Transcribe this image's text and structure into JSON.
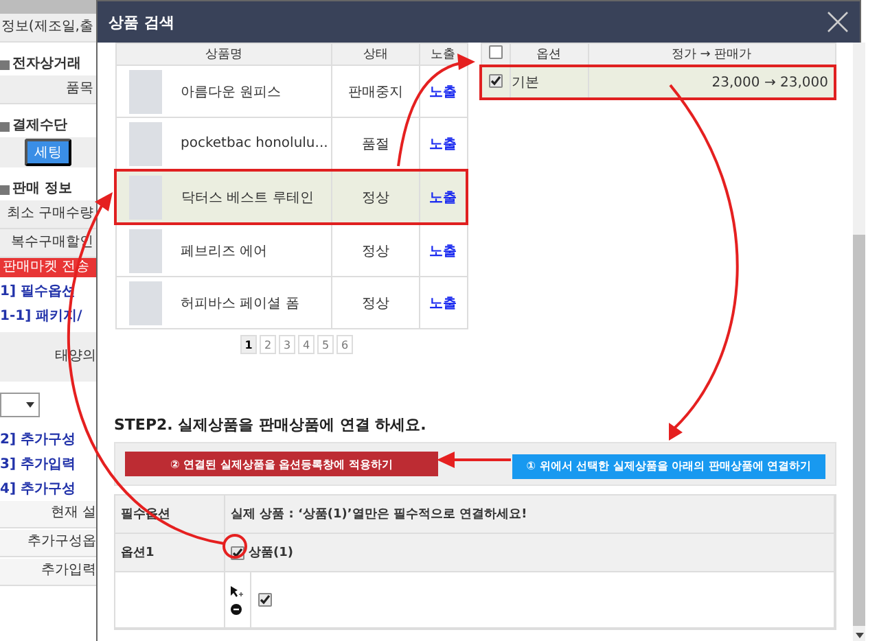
{
  "background": {
    "rows": [
      {
        "kind": "cell",
        "text": "정보(제조일,출"
      },
      {
        "kind": "heading",
        "text": "전자상거래"
      },
      {
        "kind": "cell",
        "text": "품목"
      },
      {
        "kind": "heading",
        "text": "결제수단"
      },
      {
        "kind": "button",
        "text": "세팅"
      },
      {
        "kind": "heading",
        "text": "판매 정보"
      },
      {
        "kind": "cell",
        "text": "최소 구매수량"
      },
      {
        "kind": "cell",
        "text": "복수구매할인"
      },
      {
        "kind": "alert",
        "text": "판매마켓 전송"
      },
      {
        "kind": "link",
        "text": "1] 필수옵션"
      },
      {
        "kind": "link",
        "text": "1-1] 패키지/"
      },
      {
        "kind": "tall",
        "text": "태양의"
      },
      {
        "kind": "select"
      },
      {
        "kind": "link",
        "text": "2] 추가구성"
      },
      {
        "kind": "link",
        "text": "3] 추가입력"
      },
      {
        "kind": "link",
        "text": "4] 추가구성"
      },
      {
        "kind": "right",
        "text": "현재 설"
      },
      {
        "kind": "right",
        "text": "추가구성옵"
      },
      {
        "kind": "right",
        "text": "추가입력"
      }
    ]
  },
  "modal": {
    "title": "상품 검색",
    "products": {
      "columns": [
        "상품명",
        "상태",
        "노출"
      ],
      "rows": [
        {
          "name": "아름다운 원피스",
          "status": "판매중지",
          "exposure": "노출",
          "selected": false
        },
        {
          "name": "pocketbac honolulu...",
          "status": "품절",
          "exposure": "노출",
          "selected": false
        },
        {
          "name": "닥터스 베스트 루테인",
          "status": "정상",
          "exposure": "노출",
          "selected": true
        },
        {
          "name": "페브리즈 에어",
          "status": "정상",
          "exposure": "노출",
          "selected": false
        },
        {
          "name": "허피바스 페이셜 폼",
          "status": "정상",
          "exposure": "노출",
          "selected": false
        }
      ]
    },
    "pagination": [
      {
        "label": "1",
        "selected": true
      },
      {
        "label": "2",
        "selected": false
      },
      {
        "label": "3",
        "selected": false
      },
      {
        "label": "4",
        "selected": false
      },
      {
        "label": "5",
        "selected": false
      },
      {
        "label": "6",
        "selected": false
      }
    ],
    "options": {
      "header_checked": false,
      "columns": [
        "옵션",
        "정가 → 판매가"
      ],
      "rows": [
        {
          "checked": true,
          "name": "기본",
          "price": "23,000 → 23,000",
          "selected": true
        }
      ]
    },
    "step2": {
      "title": "STEP2. 실제상품을 판매상품에 연결 하세요.",
      "buttons": [
        {
          "kind": "apply",
          "label": "② 연결된 실제상품을 옵션등록창에 적용하기"
        },
        {
          "kind": "link",
          "label": "① 위에서 선택한 실제상품을 아래의 판매상품에 연결하기"
        }
      ],
      "header_label": "필수옵션",
      "header_note": "실제 상품 : ‘상품(1)’열만은 필수적으로 연결하세요!",
      "rows": [
        {
          "label": "옵션1",
          "product": "상품(1)",
          "checked": true
        }
      ],
      "sub_checked": true
    }
  }
}
